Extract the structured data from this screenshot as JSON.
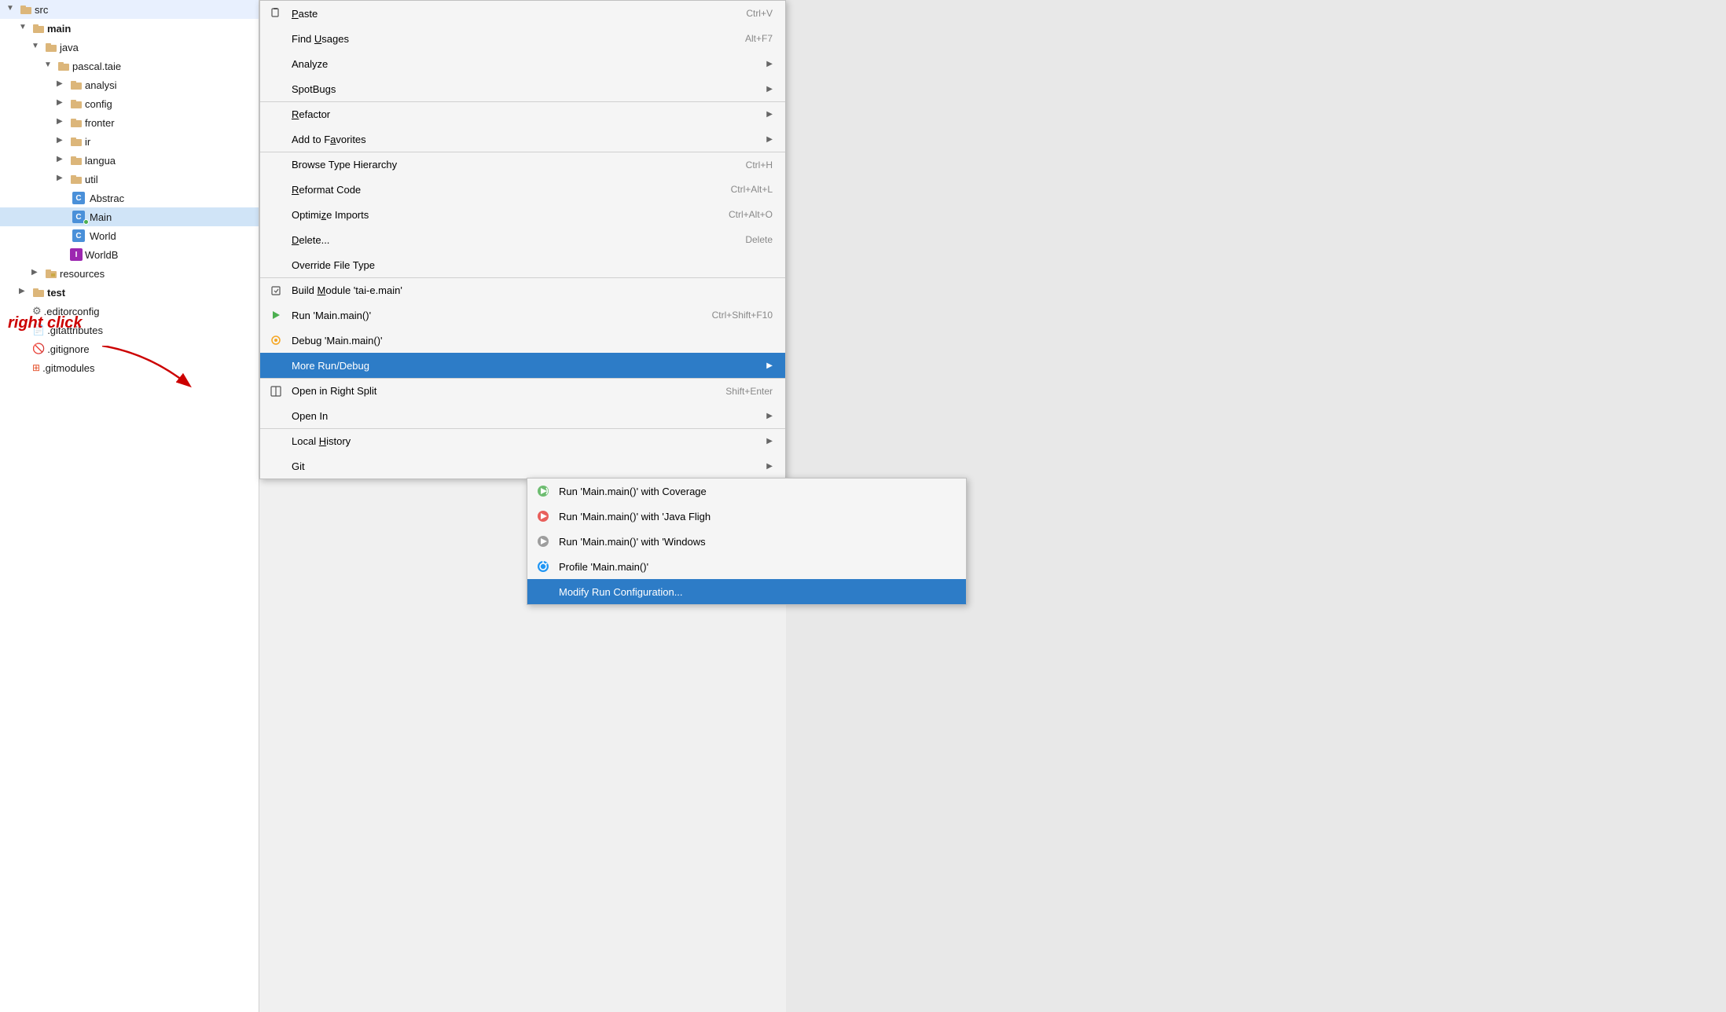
{
  "fileTree": {
    "items": [
      {
        "id": "src",
        "label": "src",
        "indent": 1,
        "type": "folder",
        "expanded": true,
        "chevron": "▼"
      },
      {
        "id": "main",
        "label": "main",
        "indent": 2,
        "type": "folder",
        "expanded": true,
        "chevron": "▼",
        "bold": true
      },
      {
        "id": "java",
        "label": "java",
        "indent": 3,
        "type": "folder",
        "expanded": true,
        "chevron": "▼"
      },
      {
        "id": "pascal.taie",
        "label": "pascal.taie",
        "indent": 4,
        "type": "folder",
        "expanded": true,
        "chevron": "▼"
      },
      {
        "id": "analysis",
        "label": "analysi",
        "indent": 5,
        "type": "folder",
        "chevron": "▶"
      },
      {
        "id": "config",
        "label": "config",
        "indent": 5,
        "type": "folder",
        "chevron": "▶"
      },
      {
        "id": "frontend",
        "label": "fronter",
        "indent": 5,
        "type": "folder",
        "chevron": "▶"
      },
      {
        "id": "ir",
        "label": "ir",
        "indent": 5,
        "type": "folder",
        "chevron": "▶"
      },
      {
        "id": "language",
        "label": "langua",
        "indent": 5,
        "type": "folder",
        "chevron": "▶"
      },
      {
        "id": "util",
        "label": "util",
        "indent": 5,
        "type": "folder",
        "chevron": "▶"
      },
      {
        "id": "AbstractClass",
        "label": "Abstrac",
        "indent": 5,
        "type": "class-c",
        "chevron": ""
      },
      {
        "id": "Main",
        "label": "Main",
        "indent": 5,
        "type": "class-c-green",
        "chevron": "",
        "selected": true
      },
      {
        "id": "World",
        "label": "World",
        "indent": 5,
        "type": "class-c",
        "chevron": ""
      },
      {
        "id": "WorldB",
        "label": "WorldB",
        "indent": 5,
        "type": "class-i",
        "chevron": ""
      },
      {
        "id": "resources",
        "label": "resources",
        "indent": 3,
        "type": "folder-res",
        "chevron": "▶"
      },
      {
        "id": "test",
        "label": "test",
        "indent": 2,
        "type": "folder",
        "expanded": false,
        "chevron": "▶",
        "bold": true
      },
      {
        "id": "editorconfig",
        "label": ".editorconfig",
        "indent": 2,
        "type": "gear"
      },
      {
        "id": "gitattributes",
        "label": ".gitattributes",
        "indent": 2,
        "type": "doc"
      },
      {
        "id": "gitignore",
        "label": ".gitignore",
        "indent": 2,
        "type": "no-circle"
      },
      {
        "id": "gitmodules",
        "label": ".gitmodules",
        "indent": 2,
        "type": "git"
      }
    ]
  },
  "contextMenu": {
    "items": [
      {
        "id": "paste",
        "label": "Paste",
        "shortcut": "Ctrl+V",
        "icon": "paste",
        "underline_pos": null,
        "separator_above": false
      },
      {
        "id": "find-usages",
        "label": "Find Usages",
        "shortcut": "Alt+F7",
        "underline_char": "U",
        "separator_above": false
      },
      {
        "id": "analyze",
        "label": "Analyze",
        "shortcut": "",
        "arrow": true,
        "separator_above": false
      },
      {
        "id": "spotbugs",
        "label": "SpotBugs",
        "shortcut": "",
        "arrow": true,
        "separator_above": false
      },
      {
        "id": "refactor",
        "label": "Refactor",
        "shortcut": "",
        "arrow": true,
        "separator_above": true,
        "underline_char": "R"
      },
      {
        "id": "add-favorites",
        "label": "Add to Favorites",
        "shortcut": "",
        "arrow": true,
        "separator_above": false
      },
      {
        "id": "browse-hierarchy",
        "label": "Browse Type Hierarchy",
        "shortcut": "Ctrl+H",
        "separator_above": true
      },
      {
        "id": "reformat-code",
        "label": "Reformat Code",
        "shortcut": "Ctrl+Alt+L",
        "underline_char": "R"
      },
      {
        "id": "optimize-imports",
        "label": "Optimize Imports",
        "shortcut": "Ctrl+Alt+O",
        "underline_char": "z"
      },
      {
        "id": "delete",
        "label": "Delete...",
        "shortcut": "Delete",
        "underline_char": "D"
      },
      {
        "id": "override-file-type",
        "label": "Override File Type",
        "shortcut": "",
        "separator_above": false
      },
      {
        "id": "build-module",
        "label": "Build Module 'tai-e.main'",
        "shortcut": "",
        "separator_above": true,
        "icon": "build"
      },
      {
        "id": "run-main",
        "label": "Run 'Main.main()'",
        "shortcut": "Ctrl+Shift+F10",
        "icon": "run",
        "separator_above": false
      },
      {
        "id": "debug-main",
        "label": "Debug 'Main.main()'",
        "shortcut": "",
        "icon": "debug",
        "separator_above": false
      },
      {
        "id": "more-run-debug",
        "label": "More Run/Debug",
        "shortcut": "",
        "arrow": true,
        "highlighted": true,
        "separator_above": false
      },
      {
        "id": "open-right-split",
        "label": "Open in Right Split",
        "shortcut": "Shift+Enter",
        "icon": "split",
        "separator_above": true
      },
      {
        "id": "open-in",
        "label": "Open In",
        "shortcut": "",
        "arrow": true,
        "separator_above": false
      },
      {
        "id": "local-history",
        "label": "Local History",
        "shortcut": "",
        "arrow": true,
        "underline_char": "H",
        "separator_above": true
      },
      {
        "id": "git",
        "label": "Git",
        "shortcut": "",
        "arrow": true,
        "separator_above": false
      }
    ]
  },
  "submenu": {
    "items": [
      {
        "id": "run-coverage",
        "label": "Run 'Main.main()' with Coverage",
        "icon": "coverage"
      },
      {
        "id": "run-java-flight",
        "label": "Run 'Main.main()' with 'Java Fligh",
        "icon": "java-flight"
      },
      {
        "id": "run-windows",
        "label": "Run 'Main.main()' with 'Windows",
        "icon": "windows"
      },
      {
        "id": "profile",
        "label": "Profile 'Main.main()'",
        "icon": "profile"
      },
      {
        "id": "modify-run-config",
        "label": "Modify Run Configuration...",
        "highlighted": true
      }
    ]
  },
  "annotation": {
    "text": "right click",
    "arrowTarget": "Main class"
  }
}
